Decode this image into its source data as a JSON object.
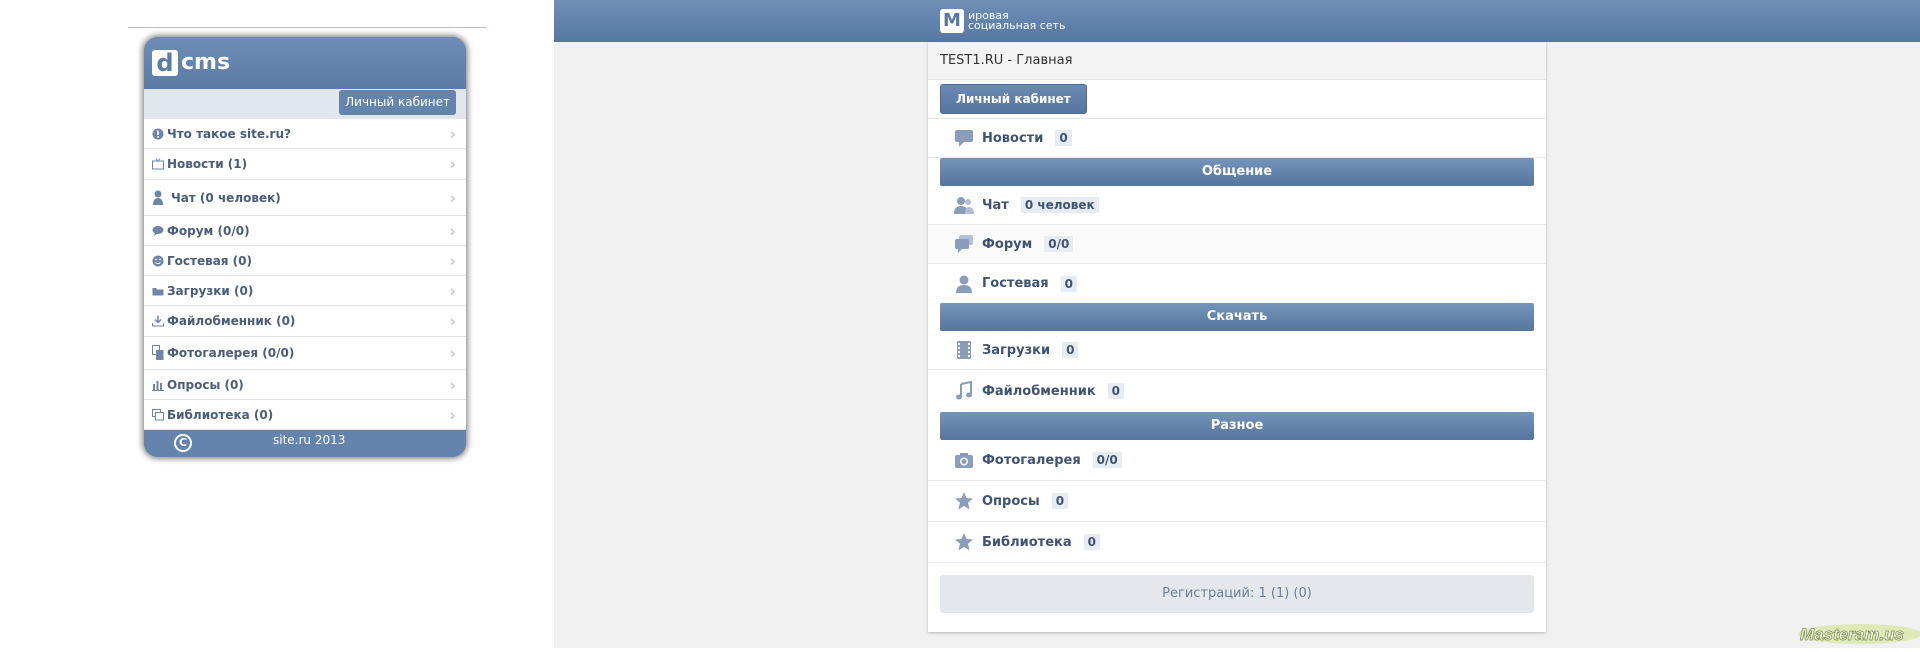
{
  "left": {
    "logo_letter": "d",
    "logo_text": "cms",
    "cabinet_label": "Личный кабинет",
    "menu": [
      {
        "icon": "info-icon",
        "label": "Что такое site.ru?"
      },
      {
        "icon": "tv-icon",
        "label": "Новости (1)"
      },
      {
        "icon": "users-icon",
        "label": "Чат (0 человек)"
      },
      {
        "icon": "speech-bubble-icon",
        "label": "Форум (0/0)"
      },
      {
        "icon": "smiley-icon",
        "label": "Гостевая (0)"
      },
      {
        "icon": "folder-icon",
        "label": "Загрузки (0)"
      },
      {
        "icon": "download-icon",
        "label": "Файлобменник (0)"
      },
      {
        "icon": "photo-icon",
        "label": "Фотогалерея (0/0)"
      },
      {
        "icon": "bar-chart-icon",
        "label": "Опросы (0)"
      },
      {
        "icon": "books-icon",
        "label": "Библиотека (0)"
      }
    ],
    "copyright_symbol": "C",
    "footer_text": "site.ru 2013"
  },
  "right": {
    "brand_letter": "M",
    "brand_line1": "ировая",
    "brand_line2": "социальная сеть",
    "breadcrumb": "TEST1.RU - Главная",
    "cabinet_button": "Личный кабинет",
    "news": {
      "icon": "comment-icon",
      "label": "Новости",
      "count": "0"
    },
    "sections": [
      {
        "title": "Общение",
        "items": [
          {
            "icon": "users-icon",
            "label": "Чат",
            "count": "0 человек"
          },
          {
            "icon": "comments-icon",
            "label": "Форум",
            "count": "0/0"
          },
          {
            "icon": "user-icon",
            "label": "Гостевая",
            "count": "0"
          }
        ]
      },
      {
        "title": "Скачать",
        "items": [
          {
            "icon": "film-icon",
            "label": "Загрузки",
            "count": "0"
          },
          {
            "icon": "music-icon",
            "label": "Файлобменник",
            "count": "0"
          }
        ]
      },
      {
        "title": "Разное",
        "items": [
          {
            "icon": "camera-icon",
            "label": "Фотогалерея",
            "count": "0/0"
          },
          {
            "icon": "star-icon",
            "label": "Опросы",
            "count": "0"
          },
          {
            "icon": "star-icon",
            "label": "Библиотека",
            "count": "0"
          }
        ]
      }
    ],
    "registrations": "Регистраций: 1 (1) (0)",
    "watermark": "Masteram.us"
  },
  "colors": {
    "accent": "#5c7ba5",
    "header_gradient_top": "#6f8fb7",
    "badge_bg": "#e7ecf2",
    "text": "#3f5373"
  }
}
